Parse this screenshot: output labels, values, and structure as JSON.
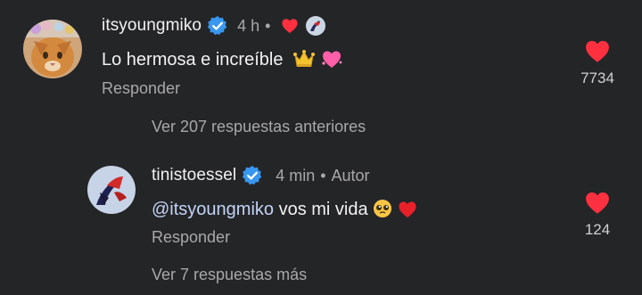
{
  "comment1": {
    "username": "itsyoungmiko",
    "time": "4 h",
    "dot": "•",
    "text": "Lo hermosa e increíble",
    "reply_label": "Responder",
    "like_count": "7734",
    "icons": [
      "verified-badge-icon",
      "creator-heart-icon",
      "crown-emoji",
      "heart-emoji"
    ]
  },
  "view_previous": "Ver 207 respuestas anteriores",
  "comment2": {
    "username": "tinistoessel",
    "time": "4 min",
    "dot": "•",
    "author_label": "Autor",
    "mention": "@itsyoungmiko",
    "text": " vos mi vida",
    "reply_label": "Responder",
    "like_count": "124",
    "icons": [
      "verified-badge-icon",
      "pleading-face-emoji",
      "red-heart-emoji"
    ]
  },
  "view_more": "Ver 7 respuestas más",
  "colors": {
    "background": "#242527",
    "verified": "#3897f0",
    "like_red": "#ff3040",
    "mention": "#c3d3f7",
    "muted": "#a8a8a8"
  }
}
